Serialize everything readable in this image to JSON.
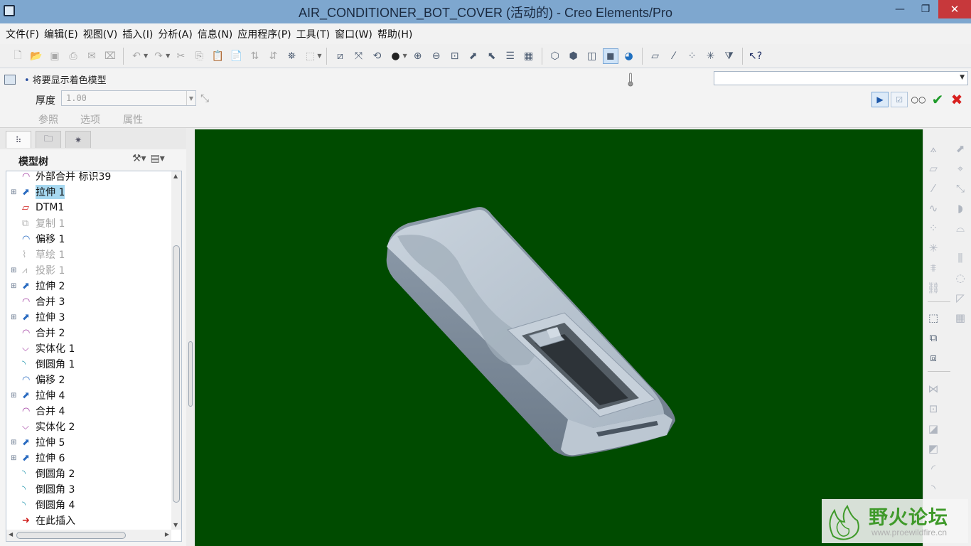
{
  "window": {
    "title": "AIR_CONDITIONER_BOT_COVER (活动的) - Creo Elements/Pro",
    "minimize_glyph": "—",
    "restore_glyph": "❐",
    "close_glyph": "✕"
  },
  "menu": [
    "文件(F)",
    "编辑(E)",
    "视图(V)",
    "插入(I)",
    "分析(A)",
    "信息(N)",
    "应用程序(P)",
    "工具(T)",
    "窗口(W)",
    "帮助(H)"
  ],
  "dashboard": {
    "message": "将要显示着色模型",
    "thickness_label": "厚度",
    "thickness_value": "1.00",
    "tabs": [
      "参照",
      "选项",
      "属性"
    ],
    "select_value": ""
  },
  "model_tree": {
    "title": "模型树",
    "items": [
      {
        "label": "外部合并 标识39",
        "icon": "merge-icon",
        "expandable": false,
        "dim": false,
        "selected": false
      },
      {
        "label": "拉伸 1",
        "icon": "extrude-icon",
        "expandable": true,
        "dim": false,
        "selected": true
      },
      {
        "label": "DTM1",
        "icon": "datum-plane-icon",
        "expandable": false,
        "dim": false,
        "selected": false
      },
      {
        "label": "复制 1",
        "icon": "copy-icon",
        "expandable": false,
        "dim": true,
        "selected": false
      },
      {
        "label": "偏移 1",
        "icon": "offset-icon",
        "expandable": false,
        "dim": false,
        "selected": false
      },
      {
        "label": "草绘 1",
        "icon": "sketch-icon",
        "expandable": false,
        "dim": true,
        "selected": false
      },
      {
        "label": "投影 1",
        "icon": "project-icon",
        "expandable": true,
        "dim": true,
        "selected": false
      },
      {
        "label": "拉伸 2",
        "icon": "extrude-icon",
        "expandable": true,
        "dim": false,
        "selected": false
      },
      {
        "label": "合并 3",
        "icon": "merge-icon",
        "expandable": false,
        "dim": false,
        "selected": false
      },
      {
        "label": "拉伸 3",
        "icon": "extrude-icon",
        "expandable": true,
        "dim": false,
        "selected": false
      },
      {
        "label": "合并 2",
        "icon": "merge-icon",
        "expandable": false,
        "dim": false,
        "selected": false
      },
      {
        "label": "实体化 1",
        "icon": "solidify-icon",
        "expandable": false,
        "dim": false,
        "selected": false
      },
      {
        "label": "倒圆角 1",
        "icon": "round-icon",
        "expandable": false,
        "dim": false,
        "selected": false
      },
      {
        "label": "偏移 2",
        "icon": "offset-icon",
        "expandable": false,
        "dim": false,
        "selected": false
      },
      {
        "label": "拉伸 4",
        "icon": "extrude-icon",
        "expandable": true,
        "dim": false,
        "selected": false
      },
      {
        "label": "合并 4",
        "icon": "merge-icon",
        "expandable": false,
        "dim": false,
        "selected": false
      },
      {
        "label": "实体化 2",
        "icon": "solidify-icon",
        "expandable": false,
        "dim": false,
        "selected": false
      },
      {
        "label": "拉伸 5",
        "icon": "extrude-icon",
        "expandable": true,
        "dim": false,
        "selected": false
      },
      {
        "label": "拉伸 6",
        "icon": "extrude-icon",
        "expandable": true,
        "dim": false,
        "selected": false
      },
      {
        "label": "倒圆角 2",
        "icon": "round-icon",
        "expandable": false,
        "dim": false,
        "selected": false
      },
      {
        "label": "倒圆角 3",
        "icon": "round-icon",
        "expandable": false,
        "dim": false,
        "selected": false
      },
      {
        "label": "倒圆角 4",
        "icon": "round-icon",
        "expandable": false,
        "dim": false,
        "selected": false
      },
      {
        "label": "在此插入",
        "icon": "insert-here-icon",
        "expandable": false,
        "dim": false,
        "selected": false
      }
    ]
  },
  "viewport": {
    "background": "#004b00",
    "model_color": "#b9c5d1"
  },
  "watermark": {
    "title": "野火论坛",
    "url": "www.proewildfire.cn"
  },
  "colors": {
    "titlebar": "#7ea7cf",
    "close_button": "#c7383b",
    "selection": "#a6d8f0",
    "ok": "#1f9b2a",
    "cancel": "#d8201e"
  }
}
